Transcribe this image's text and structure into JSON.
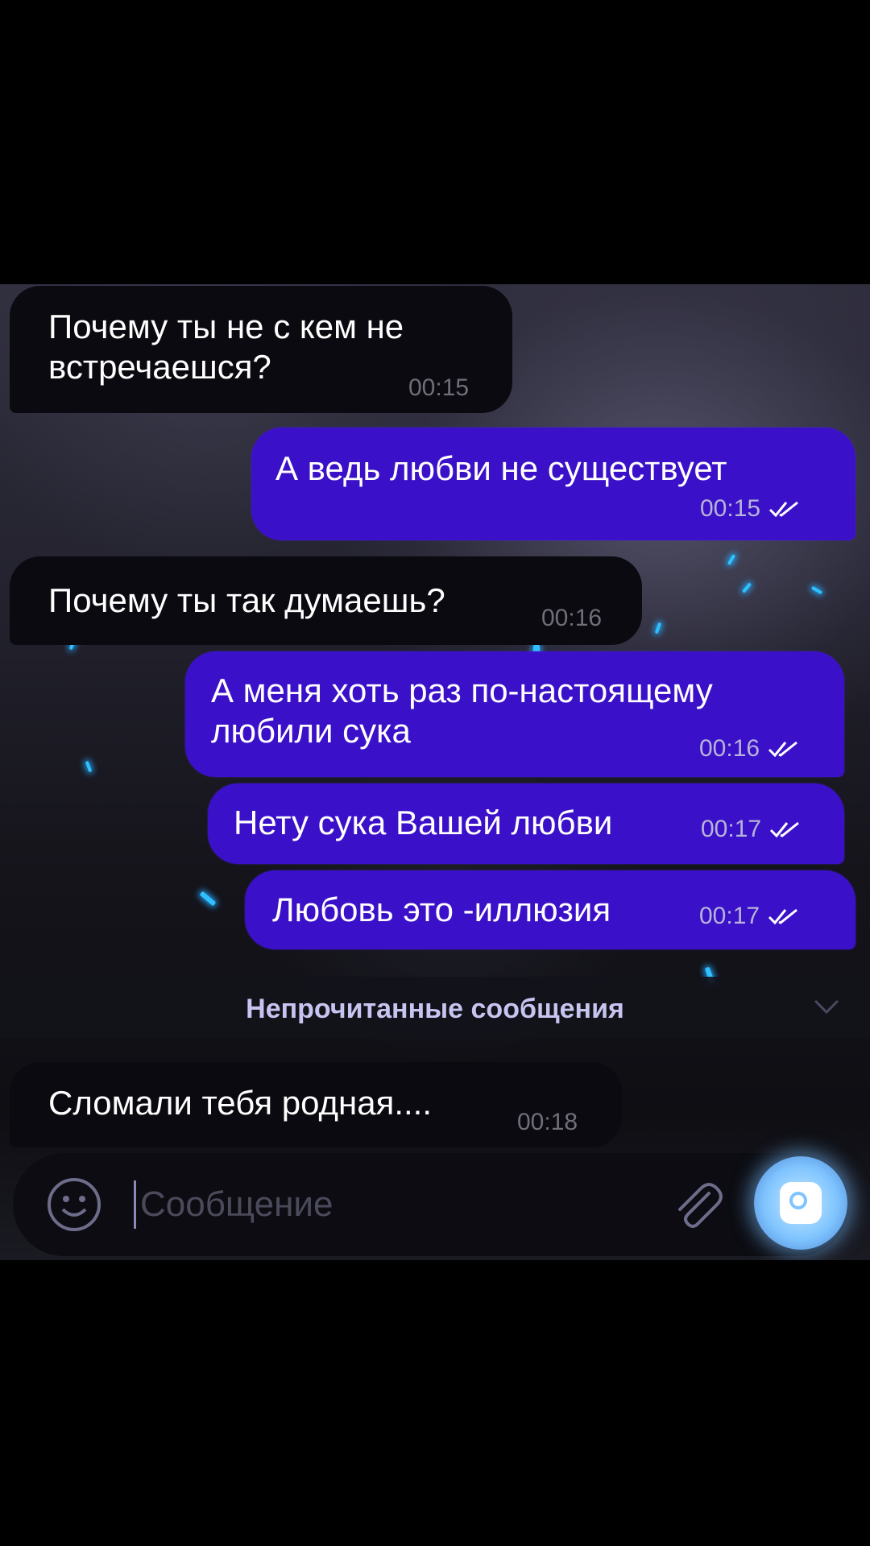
{
  "messages": [
    {
      "direction": "incoming",
      "text": "Почему ты не с кем не\nвстречаешся?",
      "time": "00:15"
    },
    {
      "direction": "outgoing",
      "text": "А ведь любви не существует",
      "time": "00:15",
      "status": "read"
    },
    {
      "direction": "incoming",
      "text": "Почему ты так думаешь?",
      "time": "00:16"
    },
    {
      "direction": "outgoing",
      "text": "А меня хоть раз по-настоящему\nлюбили сука",
      "time": "00:16",
      "status": "read"
    },
    {
      "direction": "outgoing",
      "text": "Нету сука Вашей любви",
      "time": "00:17",
      "status": "read"
    },
    {
      "direction": "outgoing",
      "text": "Любовь это -иллюзия",
      "time": "00:17",
      "status": "read"
    },
    {
      "direction": "incoming",
      "text": "Сломали тебя родная....",
      "time": "00:18"
    }
  ],
  "unread_divider": {
    "label": "Непрочитанные сообщения",
    "icon": "chevron-down-icon"
  },
  "composer": {
    "placeholder": "Сообщение",
    "emoji_icon": "smiley-icon",
    "attach_icon": "paperclip-icon",
    "send_icon": "camera-record-icon"
  },
  "colors": {
    "incoming_bubble": "#0a0a10",
    "outgoing_bubble": "#3b10c9",
    "sparkle": "#2ec0ff"
  }
}
